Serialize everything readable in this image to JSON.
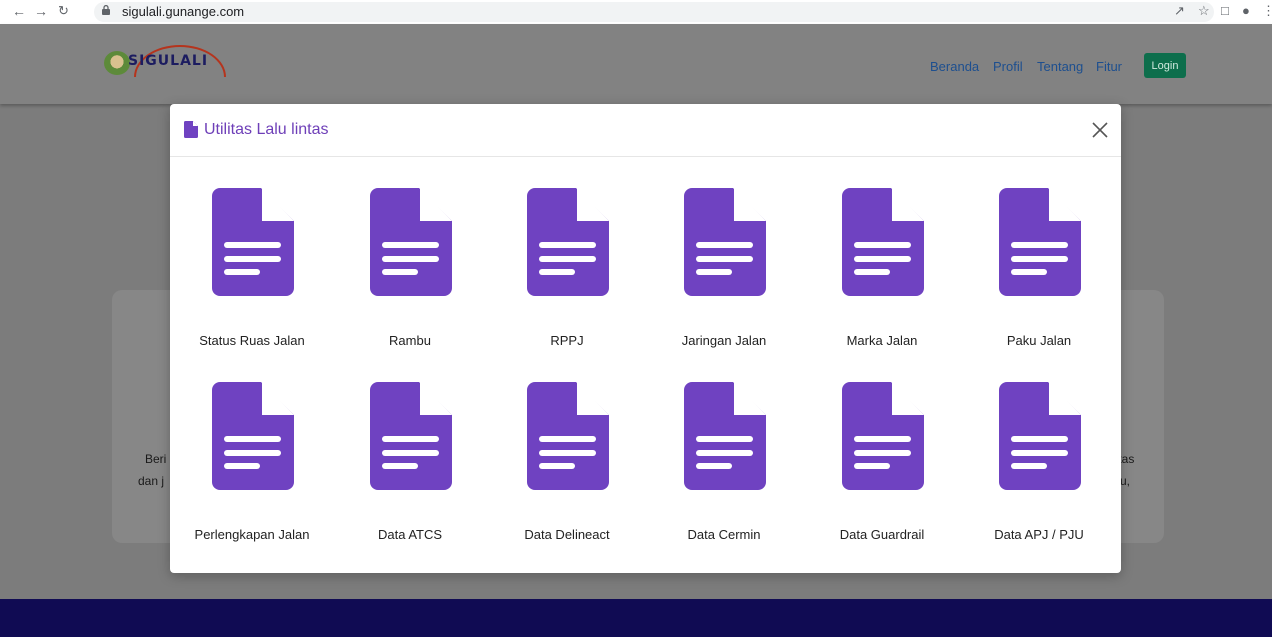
{
  "browser": {
    "url": "sigulali.gunange.com",
    "nav_icons": [
      "back-arrow-icon",
      "forward-arrow-icon",
      "reload-icon",
      "lock-icon"
    ],
    "toolbar_icons": [
      "share-icon",
      "star-icon",
      "sidebar-icon",
      "profile-icon",
      "kebab-menu-icon"
    ]
  },
  "site": {
    "logo_text": "SIGULALI",
    "nav": [
      "Beranda",
      "Profil",
      "Tentang",
      "Fitur"
    ],
    "login_label": "Login",
    "bg_text": {
      "left_line1": "Beri",
      "left_line2": "dan j",
      "right_line1": "litas",
      "right_line2": "u,"
    }
  },
  "modal": {
    "title": "Utilitas Lalu lintas",
    "title_icon": "document-icon",
    "close_icon": "close-icon",
    "items": [
      {
        "label": "Status Ruas Jalan"
      },
      {
        "label": "Rambu"
      },
      {
        "label": "RPPJ"
      },
      {
        "label": "Jaringan Jalan"
      },
      {
        "label": "Marka Jalan"
      },
      {
        "label": "Paku Jalan"
      },
      {
        "label": "Perlengkapan Jalan"
      },
      {
        "label": "Data ATCS"
      },
      {
        "label": "Data Delineact"
      },
      {
        "label": "Data Cermin"
      },
      {
        "label": "Data Guardrail"
      },
      {
        "label": "Data APJ / PJU"
      }
    ]
  },
  "colors": {
    "accent": "#6f42c1",
    "login_button": "#0d6e4c",
    "footer": "#100b53",
    "nav_link": "#1d4f8f"
  }
}
